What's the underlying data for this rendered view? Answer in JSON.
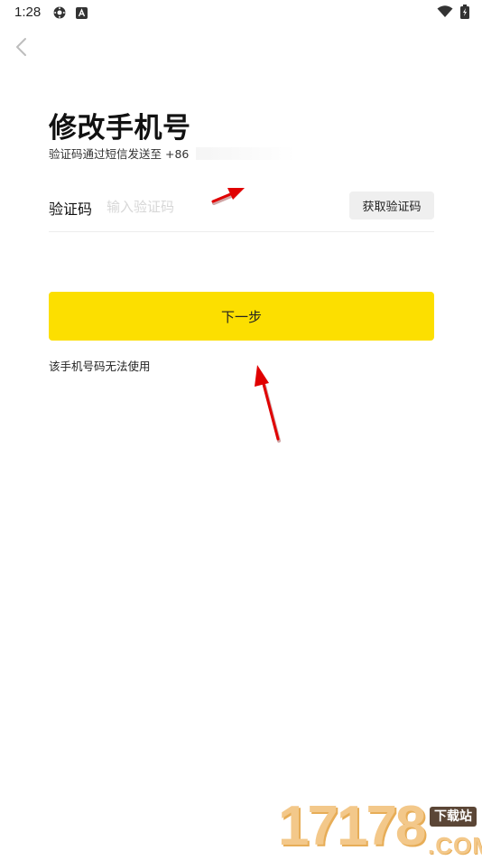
{
  "status_bar": {
    "time": "1:28",
    "left_icons": [
      "settings-gear-icon",
      "notification-a-icon"
    ],
    "right_icons": [
      "wifi-icon",
      "battery-charging-icon"
    ]
  },
  "header": {
    "back_icon": "chevron-left-icon"
  },
  "page": {
    "title": "修改手机号",
    "subtitle_prefix": "验证码通过短信发送至 +86"
  },
  "form": {
    "code_label": "验证码",
    "code_placeholder": "输入验证码",
    "code_value": "",
    "get_code_button": "获取验证码"
  },
  "actions": {
    "next_button": "下一步",
    "unusable_link": "该手机号码无法使用"
  },
  "watermark": {
    "digits": "17178",
    "tag": "下载站",
    "domain": ".COM"
  },
  "colors": {
    "accent": "#fcdf00",
    "annotation_arrow": "#e00000",
    "button_grey": "#efefef"
  }
}
